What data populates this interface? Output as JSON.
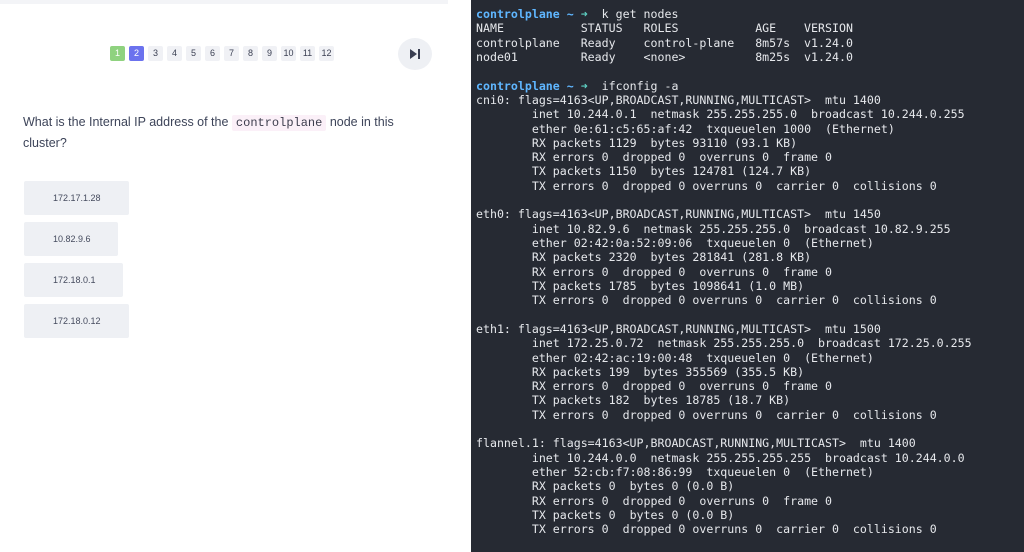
{
  "quiz": {
    "pages": [
      "1",
      "2",
      "3",
      "4",
      "5",
      "6",
      "7",
      "8",
      "9",
      "10",
      "11",
      "12"
    ],
    "question": {
      "before": "What is the Internal IP address of the ",
      "code": "controlplane",
      "after": " node in this cluster?"
    },
    "options": [
      "172.17.1.28",
      "10.82.9.6",
      "172.18.0.1",
      "172.18.0.12"
    ]
  },
  "terminal": {
    "prompt_host": "controlplane",
    "prompt_dir": "~",
    "prompt_arrow": "➜",
    "cmd1": "k get nodes",
    "nodes_header": "NAME           STATUS   ROLES           AGE    VERSION",
    "node_rows": [
      "controlplane   Ready    control-plane   8m57s  v1.24.0",
      "node01         Ready    <none>          8m25s  v1.24.0"
    ],
    "cmd2": "ifconfig -a",
    "interfaces": [
      {
        "header": "cni0: flags=4163<UP,BROADCAST,RUNNING,MULTICAST>  mtu 1400",
        "lines": [
          "inet 10.244.0.1  netmask 255.255.255.0  broadcast 10.244.0.255",
          "ether 0e:61:c5:65:af:42  txqueuelen 1000  (Ethernet)",
          "RX packets 1129  bytes 93110 (93.1 KB)",
          "RX errors 0  dropped 0  overruns 0  frame 0",
          "TX packets 1150  bytes 124781 (124.7 KB)",
          "TX errors 0  dropped 0 overruns 0  carrier 0  collisions 0"
        ]
      },
      {
        "header": "eth0: flags=4163<UP,BROADCAST,RUNNING,MULTICAST>  mtu 1450",
        "lines": [
          "inet 10.82.9.6  netmask 255.255.255.0  broadcast 10.82.9.255",
          "ether 02:42:0a:52:09:06  txqueuelen 0  (Ethernet)",
          "RX packets 2320  bytes 281841 (281.8 KB)",
          "RX errors 0  dropped 0  overruns 0  frame 0",
          "TX packets 1785  bytes 1098641 (1.0 MB)",
          "TX errors 0  dropped 0 overruns 0  carrier 0  collisions 0"
        ]
      },
      {
        "header": "eth1: flags=4163<UP,BROADCAST,RUNNING,MULTICAST>  mtu 1500",
        "lines": [
          "inet 172.25.0.72  netmask 255.255.255.0  broadcast 172.25.0.255",
          "ether 02:42:ac:19:00:48  txqueuelen 0  (Ethernet)",
          "RX packets 199  bytes 355569 (355.5 KB)",
          "RX errors 0  dropped 0  overruns 0  frame 0",
          "TX packets 182  bytes 18785 (18.7 KB)",
          "TX errors 0  dropped 0 overruns 0  carrier 0  collisions 0"
        ]
      },
      {
        "header": "flannel.1: flags=4163<UP,BROADCAST,RUNNING,MULTICAST>  mtu 1400",
        "lines": [
          "inet 10.244.0.0  netmask 255.255.255.255  broadcast 10.244.0.0",
          "ether 52:cb:f7:08:86:99  txqueuelen 0  (Ethernet)",
          "RX packets 0  bytes 0 (0.0 B)",
          "RX errors 0  dropped 0  overruns 0  frame 0",
          "TX packets 0  bytes 0 (0.0 B)",
          "TX errors 0  dropped 0 overruns 0  carrier 0  collisions 0"
        ]
      }
    ]
  },
  "icons": {
    "skip": "skip-to-end-icon"
  },
  "colors": {
    "done": "#8fd27f",
    "current": "#6b72ee",
    "terminal_bg": "#262a33",
    "prompt": "#5fb6ff"
  }
}
